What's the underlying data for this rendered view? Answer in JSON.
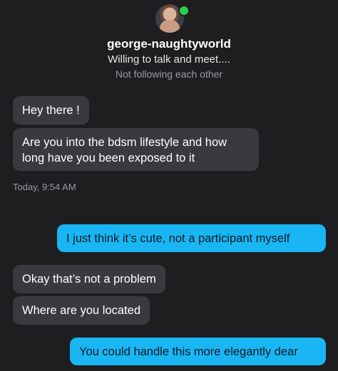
{
  "profile": {
    "username": "george-naughtyworld",
    "bio": "Willing to talk and meet....",
    "follow_status": "Not following each other",
    "online_color": "#27d04a"
  },
  "messages": [
    {
      "sender": "them",
      "text": "Hey there !"
    },
    {
      "sender": "them",
      "text": "Are you into the bdsm lifestyle and how long have you been exposed to it"
    },
    {
      "sender": "me",
      "text": "I just think it’s cute, not a participant myself"
    },
    {
      "sender": "them",
      "text": "Okay that’s not a problem"
    },
    {
      "sender": "them",
      "text": "Where are you located"
    },
    {
      "sender": "me",
      "text": "You could handle this more elegantly dear"
    }
  ],
  "timestamp": "Today, 9:54 AM",
  "colors": {
    "background": "#1e1e21",
    "incoming_bubble": "#3a3a3e",
    "outgoing_bubble": "#19b6f3"
  }
}
